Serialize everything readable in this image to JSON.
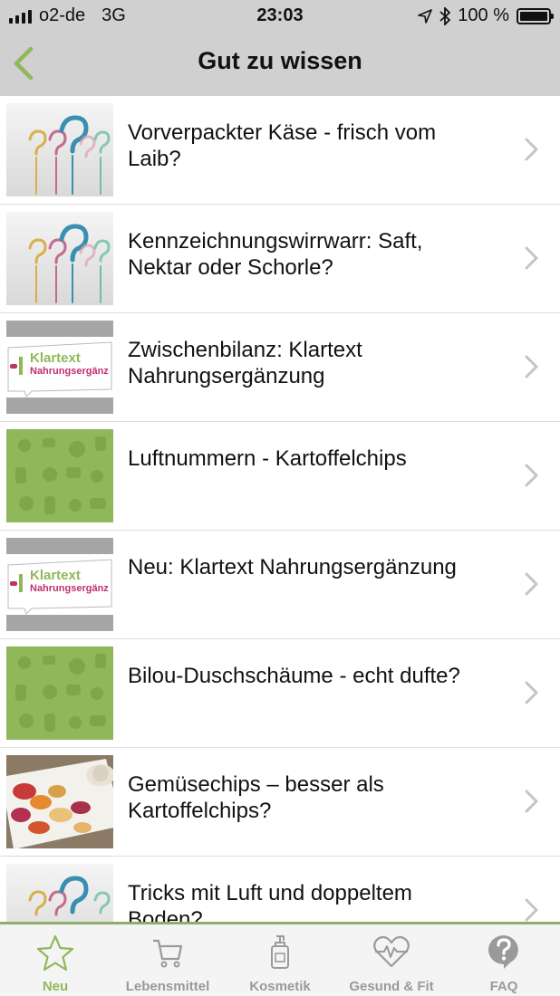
{
  "status_bar": {
    "carrier": "o2-de",
    "network": "3G",
    "time": "23:03",
    "battery": "100 %",
    "battery_level": 1.0
  },
  "nav": {
    "title": "Gut zu wissen",
    "back_icon": "chevron-left-icon"
  },
  "colors": {
    "accent": "#8fb85a",
    "nav_bg": "#d0d0d0",
    "tab_inactive": "#9a9a9a"
  },
  "articles": [
    {
      "title": "Vorverpackter Käse - frisch vom Laib?",
      "image": "question-marks"
    },
    {
      "title": "Kennzeichnungswirrwarr: Saft, Nektar oder Schorle?",
      "image": "question-marks"
    },
    {
      "title": "Zwischenbilanz: Klartext Nahrungsergänzung",
      "image": "klartext",
      "image_text": [
        "Klartext",
        "Nahrungsergänz"
      ]
    },
    {
      "title": "Luftnummern - Kartoffelchips",
      "image": "green-pattern"
    },
    {
      "title": "Neu: Klartext Nahrungsergänzung",
      "image": "klartext",
      "image_text": [
        "Klartext",
        "Nahrungsergänz"
      ]
    },
    {
      "title": "Bilou-Duschschäume - echt dufte?",
      "image": "green-pattern"
    },
    {
      "title": "Gemüsechips – besser als Kartoffelchips?",
      "image": "vegetable-chips"
    },
    {
      "title": "Tricks mit Luft und doppeltem Boden?",
      "image": "question-marks"
    }
  ],
  "tabs": [
    {
      "label": "Neu",
      "icon": "star-icon",
      "active": true
    },
    {
      "label": "Lebensmittel",
      "icon": "cart-icon",
      "active": false
    },
    {
      "label": "Kosmetik",
      "icon": "pump-bottle-icon",
      "active": false
    },
    {
      "label": "Gesund & Fit",
      "icon": "heart-pulse-icon",
      "active": false
    },
    {
      "label": "FAQ",
      "icon": "question-bubble-icon",
      "active": false
    }
  ]
}
